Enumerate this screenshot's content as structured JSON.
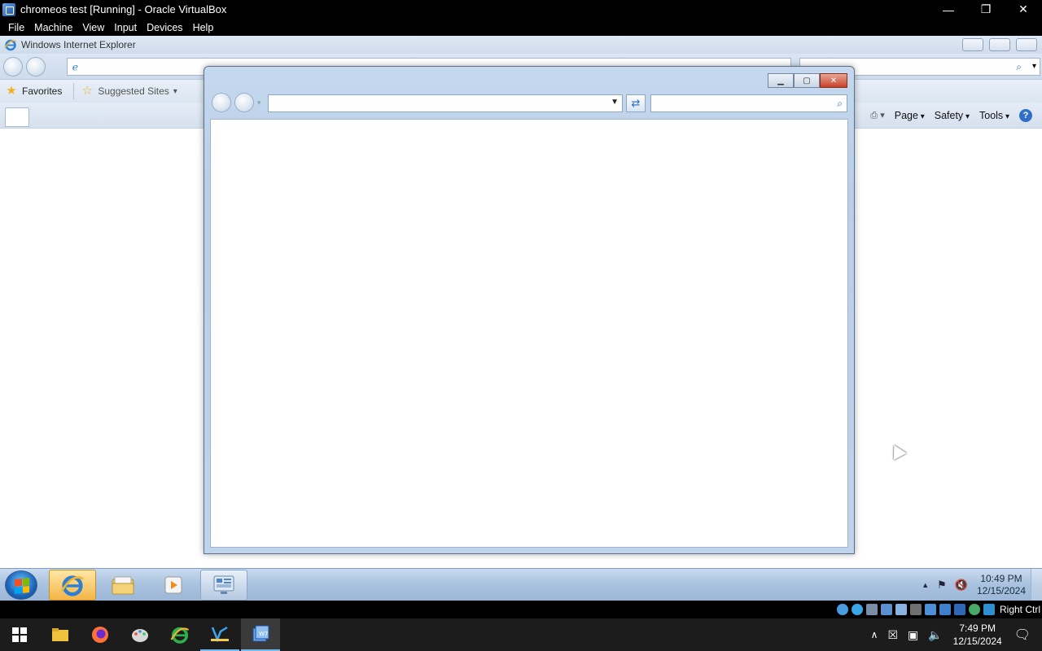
{
  "vbox": {
    "title": "chromeos test [Running] - Oracle VirtualBox",
    "menu": [
      "File",
      "Machine",
      "View",
      "Input",
      "Devices",
      "Help"
    ],
    "host_key": "Right Ctrl"
  },
  "ie_background": {
    "title": "Windows Internet Explorer",
    "favorites_label": "Favorites",
    "suggested_sites_label": "Suggested Sites",
    "commands": [
      "Page",
      "Safety",
      "Tools"
    ]
  },
  "guest_taskbar": {
    "time": "10:49 PM",
    "date": "12/15/2024"
  },
  "host_taskbar": {
    "time": "7:49 PM",
    "date": "12/15/2024"
  },
  "colors": {
    "vbox_chrome": "#000000",
    "ie_frame": "#c5d8ee",
    "close_red": "#c5432a",
    "w7_taskbar": "#a9c2df",
    "host_taskbar": "#1c1c1c"
  }
}
